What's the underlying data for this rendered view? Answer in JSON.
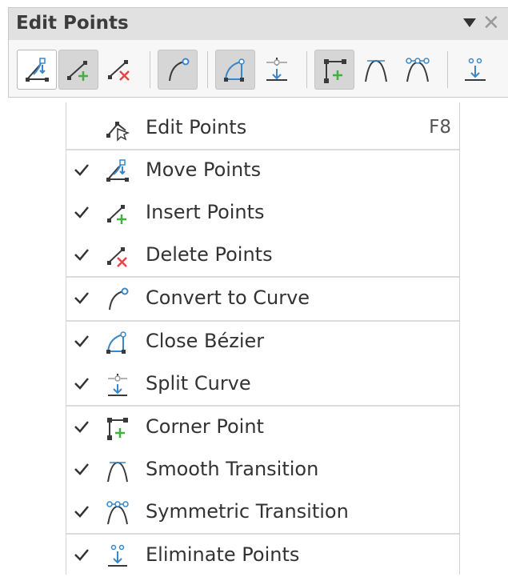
{
  "toolbar": {
    "title": "Edit Points",
    "buttons": [
      {
        "name": "move-points-button",
        "icon": "move-points-icon"
      },
      {
        "name": "insert-points-button",
        "icon": "insert-points-icon"
      },
      {
        "name": "delete-points-button",
        "icon": "delete-points-icon"
      },
      {
        "name": "convert-to-curve-button",
        "icon": "convert-to-curve-icon"
      },
      {
        "name": "close-bezier-button",
        "icon": "close-bezier-icon"
      },
      {
        "name": "split-curve-button",
        "icon": "split-curve-icon"
      },
      {
        "name": "corner-point-button",
        "icon": "corner-point-icon"
      },
      {
        "name": "smooth-transition-button",
        "icon": "smooth-transition-icon"
      },
      {
        "name": "symmetric-transition-button",
        "icon": "symmetric-transition-icon"
      },
      {
        "name": "eliminate-points-button",
        "icon": "eliminate-points-icon"
      }
    ]
  },
  "menu": {
    "items": [
      {
        "label": "Edit Points",
        "shortcut": "F8",
        "checked": false,
        "icon": "edit-points-icon"
      },
      {
        "label": "Move Points",
        "checked": true,
        "icon": "move-points-icon"
      },
      {
        "label": "Insert Points",
        "checked": true,
        "icon": "insert-points-icon"
      },
      {
        "label": "Delete Points",
        "checked": true,
        "icon": "delete-points-icon"
      },
      {
        "label": "Convert to Curve",
        "checked": true,
        "icon": "convert-to-curve-icon"
      },
      {
        "label": "Close Bézier",
        "checked": true,
        "icon": "close-bezier-icon"
      },
      {
        "label": "Split Curve",
        "checked": true,
        "icon": "split-curve-icon"
      },
      {
        "label": "Corner Point",
        "checked": true,
        "icon": "corner-point-icon"
      },
      {
        "label": "Smooth Transition",
        "checked": true,
        "icon": "smooth-transition-icon"
      },
      {
        "label": "Symmetric Transition",
        "checked": true,
        "icon": "symmetric-transition-icon"
      },
      {
        "label": "Eliminate Points",
        "checked": true,
        "icon": "eliminate-points-icon"
      }
    ]
  },
  "colors": {
    "icon_blue": "#3a87c8",
    "icon_green": "#40b040",
    "icon_red": "#e04848",
    "icon_dark": "#3a3a3a"
  }
}
